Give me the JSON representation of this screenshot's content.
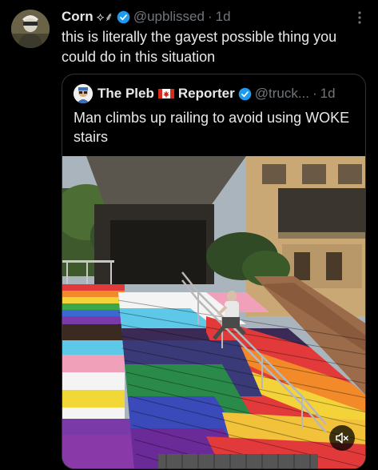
{
  "tweet": {
    "author_name": "Corn",
    "author_emoji": "⟡⸙",
    "handle": "@upblissed",
    "separator": "·",
    "time": "1d",
    "text": "this is literally the gayest possible thing you could do in this situation"
  },
  "quote": {
    "author_name_part1": "The Pleb",
    "author_name_part2": "Reporter",
    "handle": "@truck...",
    "separator": "·",
    "time": "1d",
    "text": "Man climbs up railing to avoid using WOKE stairs"
  },
  "icons": {
    "verified": "verified-badge-icon",
    "more": "more-options-icon",
    "mute": "speaker-muted-icon",
    "flag": "canada-flag-icon"
  },
  "colors": {
    "background": "#000000",
    "text": "#e7e9ea",
    "secondary": "#71767b",
    "verified": "#1d9bf0",
    "border": "#2f3336"
  }
}
